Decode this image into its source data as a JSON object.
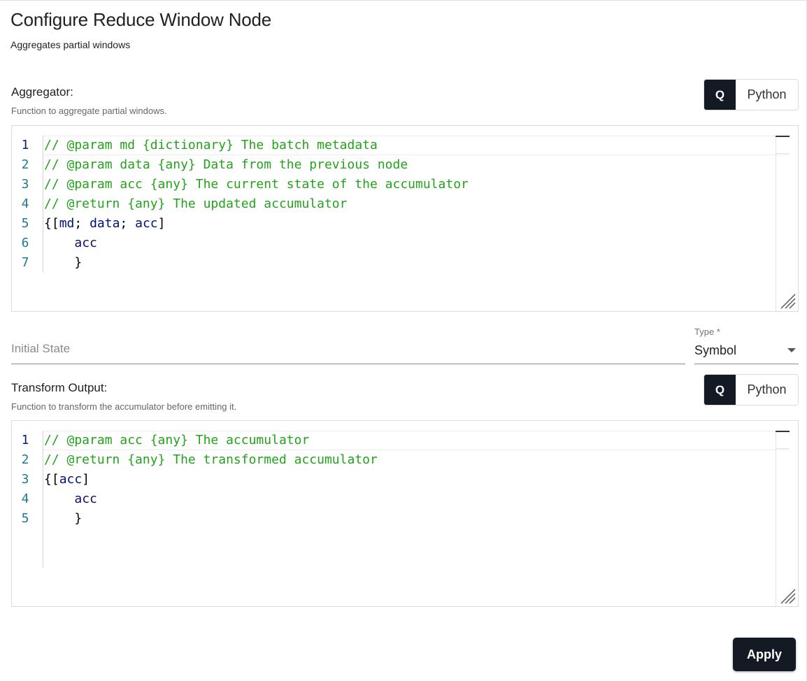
{
  "header": {
    "title": "Configure Reduce Window Node",
    "subtitle": "Aggregates partial windows"
  },
  "aggregator": {
    "label": "Aggregator:",
    "help": "Function to aggregate partial windows.",
    "toggle": {
      "q_label": "Q",
      "python_label": "Python",
      "selected": "Q"
    },
    "lines": [
      {
        "num": "1",
        "parts": [
          {
            "t": "// @param md {dictionary} The batch metadata",
            "c": "c-comment"
          }
        ]
      },
      {
        "num": "2",
        "parts": [
          {
            "t": "// @param data {any} Data from the previous node",
            "c": "c-comment"
          }
        ]
      },
      {
        "num": "3",
        "parts": [
          {
            "t": "// @param acc {any} The current state of the accumulator",
            "c": "c-comment"
          }
        ]
      },
      {
        "num": "4",
        "parts": [
          {
            "t": "// @return {any} The updated accumulator",
            "c": "c-comment"
          }
        ]
      },
      {
        "num": "5",
        "parts": [
          {
            "t": "{[",
            "c": "c-punc"
          },
          {
            "t": "md",
            "c": "c-ident"
          },
          {
            "t": "; ",
            "c": "c-punc"
          },
          {
            "t": "data",
            "c": "c-ident"
          },
          {
            "t": "; ",
            "c": "c-punc"
          },
          {
            "t": "acc",
            "c": "c-ident"
          },
          {
            "t": "]",
            "c": "c-punc"
          }
        ]
      },
      {
        "num": "6",
        "parts": [
          {
            "t": "    ",
            "c": "c-punc"
          },
          {
            "t": "acc",
            "c": "c-kw"
          }
        ]
      },
      {
        "num": "7",
        "parts": [
          {
            "t": "    }",
            "c": "c-punc"
          }
        ]
      }
    ]
  },
  "initial_state": {
    "placeholder": "Initial State",
    "value": ""
  },
  "type_select": {
    "label": "Type *",
    "value": "Symbol"
  },
  "transform": {
    "label": "Transform Output:",
    "help": "Function to transform the accumulator before emitting it.",
    "toggle": {
      "q_label": "Q",
      "python_label": "Python",
      "selected": "Q"
    },
    "lines": [
      {
        "num": "1",
        "parts": [
          {
            "t": "// @param acc {any} The accumulator",
            "c": "c-comment"
          }
        ]
      },
      {
        "num": "2",
        "parts": [
          {
            "t": "// @return {any} The transformed accumulator",
            "c": "c-comment"
          }
        ]
      },
      {
        "num": "3",
        "parts": [
          {
            "t": "{[",
            "c": "c-punc"
          },
          {
            "t": "acc",
            "c": "c-ident"
          },
          {
            "t": "]",
            "c": "c-punc"
          }
        ]
      },
      {
        "num": "4",
        "parts": [
          {
            "t": "    ",
            "c": "c-punc"
          },
          {
            "t": "acc",
            "c": "c-kw"
          }
        ]
      },
      {
        "num": "5",
        "parts": [
          {
            "t": "    }",
            "c": "c-punc"
          }
        ]
      }
    ]
  },
  "footer": {
    "apply_label": "Apply"
  }
}
